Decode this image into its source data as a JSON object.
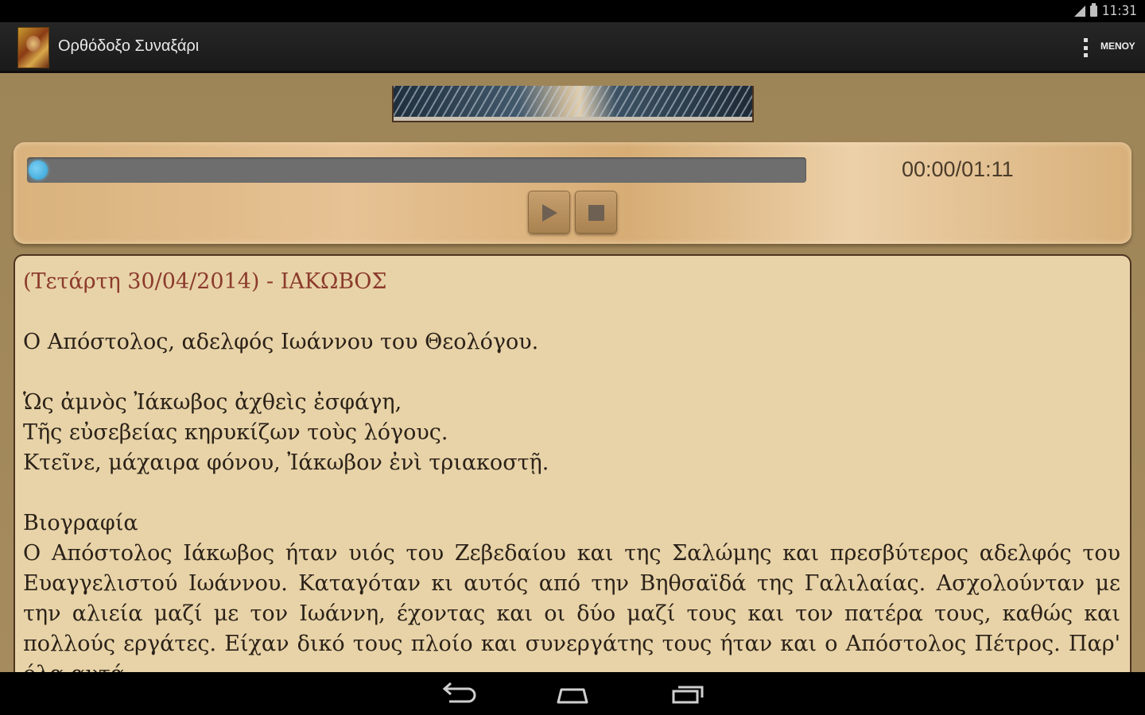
{
  "status_bar": {
    "clock": "11:31",
    "icons": [
      "signal-icon",
      "battery-icon"
    ]
  },
  "action_bar": {
    "app_title": "Ορθόδοξο Συναξάρι",
    "menu_label": "ΜΕΝΟΥ",
    "icons": [
      "app-icon",
      "overflow-menu-icon"
    ]
  },
  "player": {
    "time": "00:00/01:11",
    "progress": 0,
    "accent_color": "#2fa0d6"
  },
  "reading": {
    "date_line": "(Τετάρτη 30/04/2014) - ΙΑΚΩΒΟΣ",
    "subtitle": "Ο Απόστολος, αδελφός Ιωάννου του Θεολόγου.",
    "verses": [
      "Ὡς ἀμνὸς Ἰάκωβος ἀχθεὶς ἐσφάγη,",
      "Τῆς εὐσεβείας κηρυκίζων τοὺς λόγους.",
      "Κτεῖνε, μάχαιρα φόνου, Ἰάκωβον ἐνὶ τριακοστῇ."
    ],
    "bio_heading": "Βιογραφία",
    "bio_text": "Ο Απόστολος Ιάκωβος ήταν υιός του Ζεβεδαίου και της Σαλώμης και πρεσβύτερος αδελφός του Ευαγγελιστού Ιωάννου. Καταγόταν κι αυτός από την Βηθσαϊδά της Γαλιλαίας. Ασχολούνταν με την αλιεία μαζί με τον Ιωάννη, έχοντας και οι δύο μαζί τους και τον πατέρα τους, καθώς και πολλούς εργάτες. Είχαν δικό τους πλοίο και συνεργάτης τους ήταν και ο Απόστολος Πέτρος. Παρ' όλα αυτά"
  },
  "nav_bar": {
    "icons": [
      "back-icon",
      "home-icon",
      "recent-apps-icon"
    ]
  },
  "colors": {
    "background": "#a58b5d",
    "panel": "#e8d3a8",
    "date_text": "#8b3a2c"
  }
}
